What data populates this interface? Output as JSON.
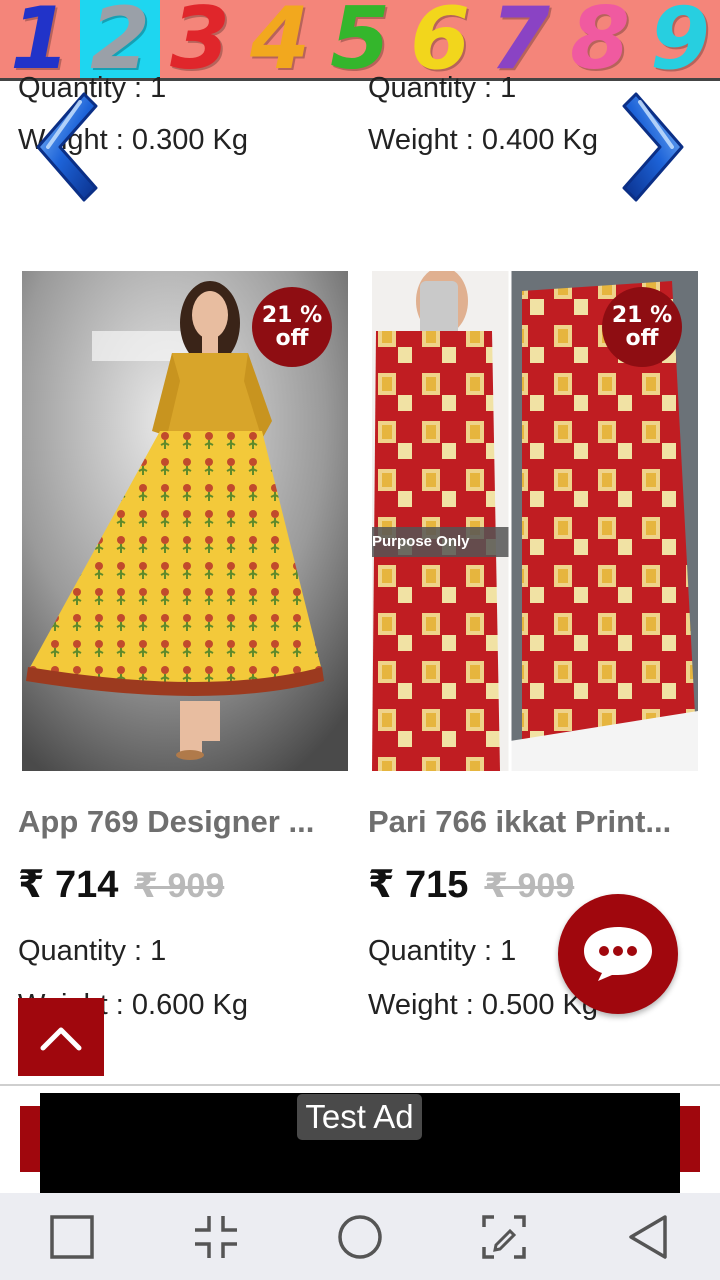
{
  "banner": {
    "digits": [
      "1",
      "2",
      "3",
      "4",
      "5",
      "6",
      "7",
      "8",
      "9"
    ],
    "digit_colors": [
      "#2133c9",
      "#9aa0a8",
      "#e0262b",
      "#f2a81e",
      "#34b62c",
      "#f2d61c",
      "#8a43c4",
      "#f05aa0",
      "#27cfe0"
    ],
    "highlighted_index": 1
  },
  "top_row": {
    "left": {
      "quantity": "Quantity : 1",
      "weight": "Weight : 0.300 Kg"
    },
    "right": {
      "quantity": "Quantity : 1",
      "weight": "Weight : 0.400 Kg"
    }
  },
  "products": [
    {
      "discount_value": "21 %",
      "discount_label": "off",
      "name": "App 769 Designer ...",
      "price": "₹ 714",
      "mrp": "₹ 909",
      "quantity": "Quantity : 1",
      "weight": "Weight : 0.600 Kg"
    },
    {
      "discount_value": "21 %",
      "discount_label": "off",
      "name": "Pari 766 ikkat Print...",
      "price": "₹ 715",
      "mrp": "₹ 909",
      "quantity": "Quantity : 1",
      "weight": "Weight : 0.500 Kg",
      "image_watermark": "Purpose Only"
    }
  ],
  "ad": {
    "label": "Test Ad"
  },
  "colors": {
    "accent": "#a0070d",
    "banner_bg": "#f4857a",
    "badge": "#8e0d12"
  },
  "icons": {
    "prev": "chevron-left-icon",
    "next": "chevron-right-icon",
    "chat": "chat-bubble-icon",
    "scroll_top": "chevron-up-icon",
    "nav": [
      "square-icon",
      "compress-icon",
      "circle-icon",
      "edit-icon",
      "triangle-back-icon"
    ]
  }
}
